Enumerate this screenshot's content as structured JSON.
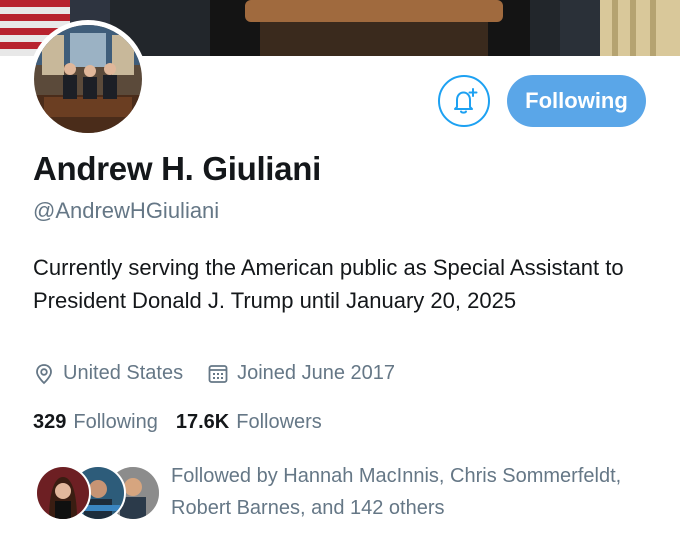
{
  "profile": {
    "name": "Andrew H. Giuliani",
    "handle": "@AndrewHGiuliani",
    "bio": "Currently serving the American public as Special Assistant to President Donald J. Trump until January 20, 2025",
    "location": "United States",
    "joined": "Joined June 2017"
  },
  "actions": {
    "follow_label": "Following",
    "notify_icon": "bell-plus-icon"
  },
  "stats": {
    "following_count": "329",
    "following_label": "Following",
    "followers_count": "17.6K",
    "followers_label": "Followers"
  },
  "followed_by": {
    "text": "Followed by Hannah MacInnis, Chris Sommerfeldt, Robert Barnes, and 142 others"
  },
  "colors": {
    "accent": "#1da1f2",
    "button_fill": "#5aa6e8",
    "secondary_text": "#657786"
  }
}
